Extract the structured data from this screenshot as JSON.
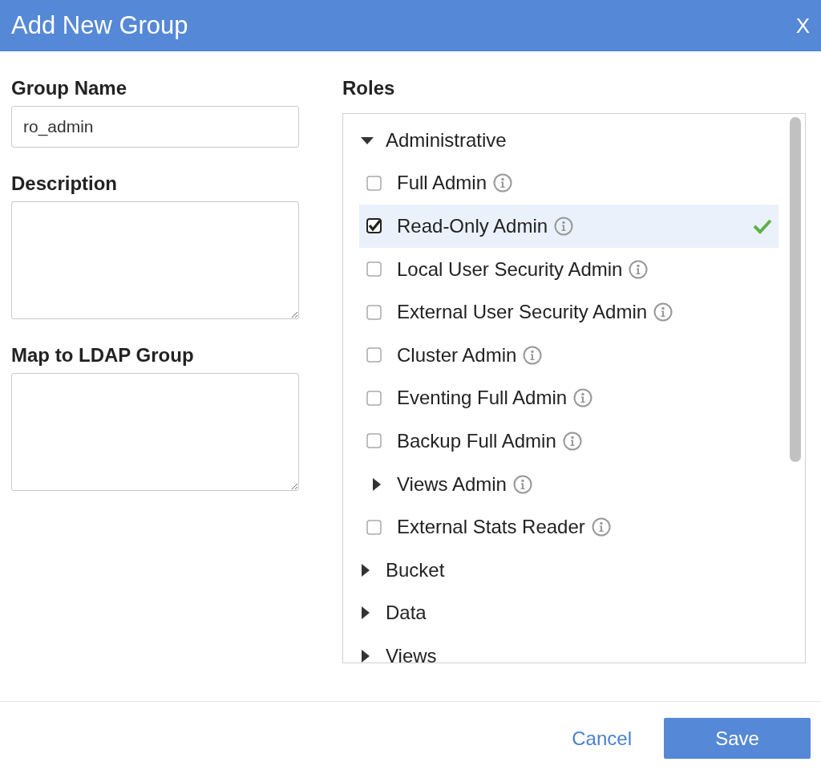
{
  "dialog": {
    "title": "Add New Group",
    "close": "X"
  },
  "form": {
    "group_name": {
      "label": "Group Name",
      "value": "ro_admin"
    },
    "description": {
      "label": "Description"
    },
    "ldap_group": {
      "label": "Map to LDAP Group"
    }
  },
  "roles": {
    "label": "Roles",
    "tree": [
      {
        "label": "Administrative",
        "kind": "group",
        "expanded": true,
        "info": false,
        "children": [
          {
            "label": "Full Admin",
            "kind": "role",
            "checked": false,
            "info": true
          },
          {
            "label": "Read-Only Admin",
            "kind": "role",
            "checked": true,
            "info": true
          },
          {
            "label": "Local User Security Admin",
            "kind": "role",
            "checked": false,
            "info": true
          },
          {
            "label": "External User Security Admin",
            "kind": "role",
            "checked": false,
            "info": true
          },
          {
            "label": "Cluster Admin",
            "kind": "role",
            "checked": false,
            "info": true
          },
          {
            "label": "Eventing Full Admin",
            "kind": "role",
            "checked": false,
            "info": true
          },
          {
            "label": "Backup Full Admin",
            "kind": "role",
            "checked": false,
            "info": true
          },
          {
            "label": "Views Admin",
            "kind": "group",
            "expanded": false,
            "info": true
          },
          {
            "label": "External Stats Reader",
            "kind": "role",
            "checked": false,
            "info": true
          }
        ]
      },
      {
        "label": "Bucket",
        "kind": "group",
        "expanded": false,
        "info": false
      },
      {
        "label": "Data",
        "kind": "group",
        "expanded": false,
        "info": false
      },
      {
        "label": "Views",
        "kind": "group",
        "expanded": false,
        "info": false
      }
    ]
  },
  "buttons": [
    {
      "label": "Cancel",
      "kind": "link"
    },
    {
      "label": "Save",
      "kind": "primary"
    }
  ]
}
